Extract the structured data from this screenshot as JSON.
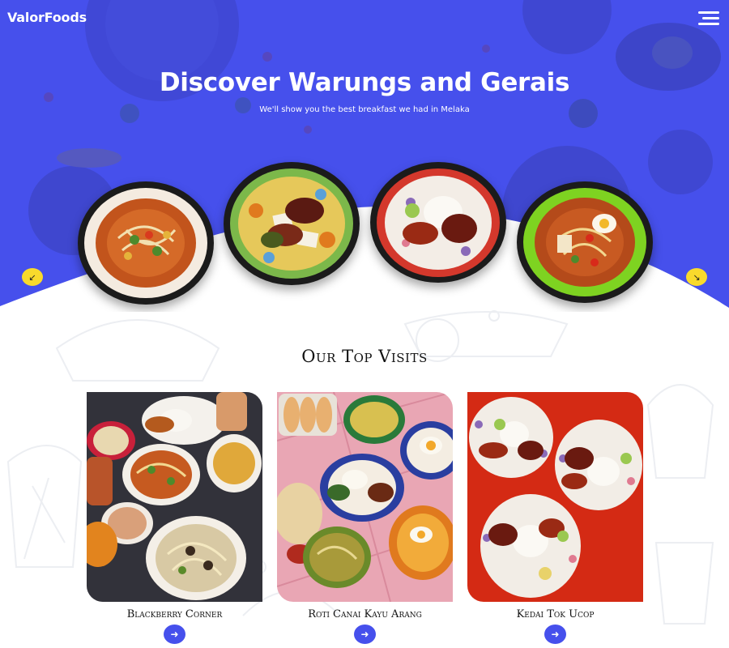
{
  "header": {
    "brand": "ValorFoods",
    "menu_icon": "hamburger-menu-icon"
  },
  "hero": {
    "title": "Discover Warungs and Gerais",
    "subtitle": "We'll show you the best breakfast we had in Melaka",
    "background_color": "#4650ec",
    "carousel": {
      "prev_icon": "↙",
      "next_icon": "↘",
      "button_color": "#f9da2c"
    }
  },
  "top_visits": {
    "title": "Our Top Visits",
    "cards": [
      {
        "name": "Blackberry Corner",
        "button_icon": "➜"
      },
      {
        "name": "Roti Canai Kayu Arang",
        "button_icon": "➜"
      },
      {
        "name": "Kedai Tok Ucop",
        "button_icon": "➜"
      }
    ],
    "button_color": "#4650ec"
  }
}
